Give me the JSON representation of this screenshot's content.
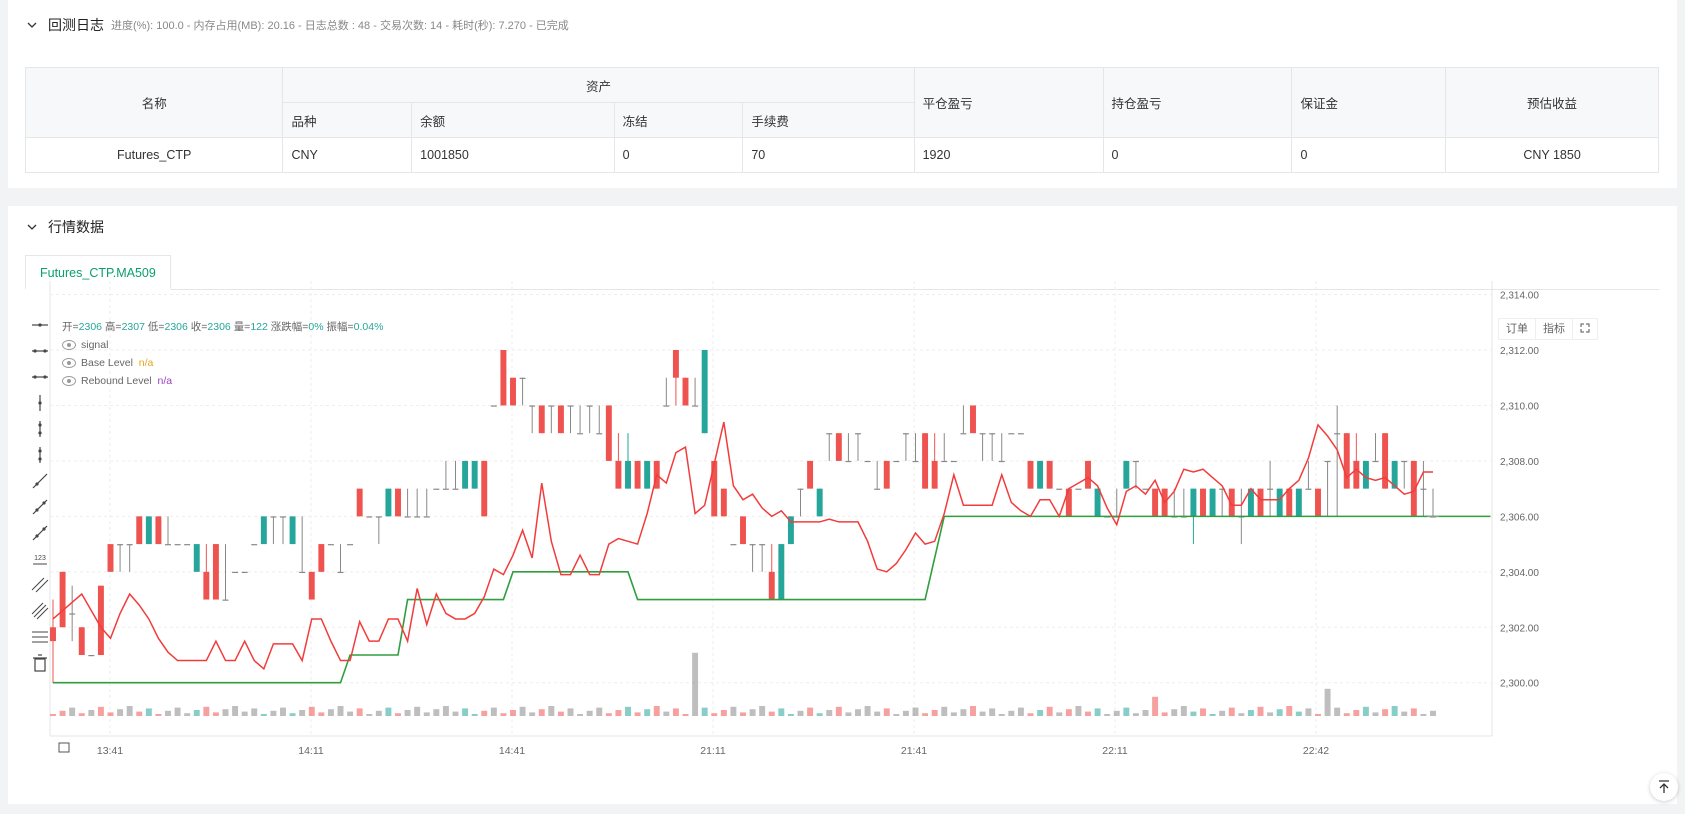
{
  "log_panel": {
    "title": "回测日志",
    "summary": "进度(%): 100.0  - 内存占用(MB): 20.16 - 日志总数 : 48 - 交易次数:  14 - 耗时(秒): 7.270 - 已完成"
  },
  "asset_table": {
    "header_name": "名称",
    "header_assets": "资产",
    "sub_headers": [
      "品种",
      "余额",
      "冻结",
      "手续费"
    ],
    "header_close_pnl": "平仓盈亏",
    "header_pos_pnl": "持仓盈亏",
    "header_margin": "保证金",
    "header_est": "预估收益",
    "row": {
      "name": "Futures_CTP",
      "symbol": "CNY",
      "balance": "1001850",
      "frozen": "0",
      "fee": "70",
      "close_pnl": "1920",
      "pos_pnl": "0",
      "margin": "0",
      "est": "CNY 1850"
    }
  },
  "market_panel": {
    "title": "行情数据",
    "tab": "Futures_CTP.MA509"
  },
  "chart_ui": {
    "btn_orders": "订单",
    "btn_indicators": "指标",
    "ohlc": {
      "open_label": "开=",
      "open": "2306",
      "high_label": "高=",
      "high": "2307",
      "low_label": "低=",
      "low": "2306",
      "close_label": "收=",
      "close": "2306",
      "vol_label": "量=",
      "vol": "122",
      "chg_label": "涨跌幅=",
      "chg": "0%",
      "amp_label": "振幅=",
      "amp": "0.04%"
    },
    "legend_signal": "signal",
    "legend_base": "Base Level",
    "legend_base_val": "n/a",
    "legend_rebound": "Rebound Level",
    "legend_rebound_val": "n/a",
    "colors": {
      "up": "#26a69a",
      "down": "#ef5350",
      "base": "#2e9e3e",
      "rebound": "#f23c3c",
      "accent": "#0a9f6b"
    },
    "tools": [
      "horizontal-line-icon",
      "horizontal-ray-icon",
      "horizontal-segment-icon",
      "vertical-line-icon",
      "vertical-ray-icon",
      "vertical-segment-icon",
      "trend-line-icon",
      "ray-line-icon",
      "segment-icon",
      "price-label-icon",
      "parallel-channel-icon",
      "fib-icon",
      "fib-lines-icon",
      "trash-icon"
    ]
  },
  "chart_data": {
    "type": "candlestick",
    "y_ticks": [
      "2,314.00",
      "2,312.00",
      "2,310.00",
      "2,308.00",
      "2,306.00",
      "2,304.00",
      "2,302.00",
      "2,300.00"
    ],
    "ylim": [
      2298.8,
      2314.2
    ],
    "x_ticks": [
      "13:41",
      "14:11",
      "14:41",
      "21:11",
      "21:41",
      "22:11",
      "22:42"
    ],
    "candles": [
      [
        2302.0,
        2303.0,
        2300.0,
        2301.5
      ],
      [
        2304.0,
        2303.0,
        2304.0,
        2302.0
      ],
      [
        2302.5,
        2303.5,
        2301.5,
        2302.5
      ],
      [
        2302.0,
        2301.0,
        2302.0,
        2301.0
      ],
      [
        2301.0,
        2301.0,
        2301.0,
        2301.0
      ],
      [
        2303.5,
        2303.5,
        2301.0,
        2301.0
      ],
      [
        2305.0,
        2305.0,
        2305.0,
        2304.0
      ],
      [
        2305.0,
        2305.0,
        2304.0,
        2305.0
      ],
      [
        2305.0,
        2305.0,
        2304.0,
        2305.0
      ],
      [
        2306.0,
        2306.0,
        2305.0,
        2305.0
      ],
      [
        2305.0,
        2306.0,
        2305.0,
        2306.0
      ],
      [
        2306.0,
        2306.0,
        2305.0,
        2305.0
      ],
      [
        2305.0,
        2306.0,
        2305.0,
        2305.0
      ],
      [
        2305.0,
        2305.0,
        2305.0,
        2305.0
      ],
      [
        2305.0,
        2305.0,
        2305.0,
        2305.0
      ],
      [
        2304.0,
        2305.0,
        2304.0,
        2305.0
      ],
      [
        2304.0,
        2305.0,
        2304.0,
        2303.0
      ],
      [
        2305.0,
        2305.0,
        2303.0,
        2303.0
      ],
      [
        2303.0,
        2305.0,
        2303.0,
        2303.0
      ],
      [
        2304.0,
        2304.0,
        2304.0,
        2304.0
      ],
      [
        2304.0,
        2304.0,
        2304.0,
        2304.0
      ],
      [
        2305.0,
        2305.0,
        2305.0,
        2305.0
      ],
      [
        2305.0,
        2306.0,
        2305.0,
        2306.0
      ],
      [
        2306.0,
        2306.0,
        2305.0,
        2306.0
      ],
      [
        2306.0,
        2306.0,
        2305.0,
        2306.0
      ],
      [
        2305.0,
        2306.0,
        2305.0,
        2306.0
      ],
      [
        2304.0,
        2306.0,
        2304.0,
        2304.0
      ],
      [
        2304.0,
        2304.0,
        2303.0,
        2303.0
      ],
      [
        2305.0,
        2304.0,
        2305.0,
        2304.0
      ],
      [
        2305.0,
        2305.0,
        2305.0,
        2305.0
      ],
      [
        2304.0,
        2305.0,
        2304.0,
        2304.0
      ],
      [
        2305.0,
        2305.0,
        2305.0,
        2305.0
      ],
      [
        2307.0,
        2307.0,
        2306.0,
        2306.0
      ],
      [
        2306.0,
        2306.0,
        2306.0,
        2306.0
      ],
      [
        2306.0,
        2306.0,
        2305.0,
        2306.0
      ],
      [
        2306.0,
        2307.0,
        2306.0,
        2307.0
      ],
      [
        2307.0,
        2307.0,
        2306.0,
        2306.0
      ],
      [
        2306.0,
        2307.0,
        2306.0,
        2306.0
      ],
      [
        2306.0,
        2307.0,
        2306.0,
        2306.0
      ],
      [
        2306.0,
        2307.0,
        2306.0,
        2306.0
      ],
      [
        2307.0,
        2307.0,
        2307.0,
        2307.0
      ],
      [
        2307.0,
        2308.0,
        2307.0,
        2307.0
      ],
      [
        2307.0,
        2308.0,
        2307.0,
        2307.0
      ],
      [
        2307.0,
        2308.0,
        2307.0,
        2308.0
      ],
      [
        2307.0,
        2308.0,
        2307.0,
        2308.0
      ],
      [
        2308.0,
        2308.0,
        2306.0,
        2306.0
      ],
      [
        2310.0,
        2310.0,
        2310.0,
        2310.0
      ],
      [
        2312.0,
        2312.0,
        2310.0,
        2310.0
      ],
      [
        2311.0,
        2311.0,
        2310.0,
        2310.0
      ],
      [
        2311.0,
        2311.0,
        2310.0,
        2311.0
      ],
      [
        2310.0,
        2310.0,
        2309.0,
        2310.0
      ],
      [
        2310.0,
        2310.0,
        2309.0,
        2309.0
      ],
      [
        2310.0,
        2310.0,
        2309.0,
        2310.0
      ],
      [
        2310.0,
        2310.0,
        2309.0,
        2309.0
      ],
      [
        2310.0,
        2310.0,
        2309.0,
        2310.0
      ],
      [
        2309.0,
        2310.0,
        2309.0,
        2309.0
      ],
      [
        2310.0,
        2310.0,
        2309.0,
        2310.0
      ],
      [
        2309.0,
        2310.0,
        2309.0,
        2309.0
      ],
      [
        2310.0,
        2310.0,
        2308.0,
        2308.0
      ],
      [
        2308.0,
        2309.0,
        2307.0,
        2307.0
      ],
      [
        2307.0,
        2309.0,
        2307.0,
        2308.0
      ],
      [
        2308.0,
        2308.0,
        2307.0,
        2307.0
      ],
      [
        2307.0,
        2308.0,
        2307.0,
        2308.0
      ],
      [
        2308.0,
        2308.0,
        2307.0,
        2307.0
      ],
      [
        2310.0,
        2311.0,
        2310.0,
        2310.0
      ],
      [
        2312.0,
        2312.0,
        2310.0,
        2311.0
      ],
      [
        2311.0,
        2311.0,
        2310.0,
        2310.0
      ],
      [
        2310.0,
        2311.0,
        2310.0,
        2310.0
      ],
      [
        2309.0,
        2312.0,
        2309.0,
        2312.0
      ],
      [
        2308.0,
        2308.0,
        2306.0,
        2306.0
      ],
      [
        2307.0,
        2307.0,
        2306.0,
        2306.0
      ],
      [
        2305.0,
        2305.0,
        2305.0,
        2305.0
      ],
      [
        2306.0,
        2306.0,
        2305.0,
        2305.0
      ],
      [
        2305.0,
        2305.0,
        2304.0,
        2305.0
      ],
      [
        2305.0,
        2305.0,
        2304.0,
        2305.0
      ],
      [
        2304.0,
        2305.0,
        2303.0,
        2303.0
      ],
      [
        2303.0,
        2305.0,
        2303.0,
        2305.0
      ],
      [
        2305.0,
        2306.0,
        2305.0,
        2306.0
      ],
      [
        2307.0,
        2307.0,
        2306.0,
        2307.0
      ],
      [
        2308.0,
        2308.0,
        2307.0,
        2307.0
      ],
      [
        2306.0,
        2307.0,
        2306.0,
        2307.0
      ],
      [
        2309.0,
        2309.0,
        2308.0,
        2309.0
      ],
      [
        2309.0,
        2309.0,
        2308.0,
        2308.0
      ],
      [
        2308.0,
        2309.0,
        2308.0,
        2308.0
      ],
      [
        2309.0,
        2309.0,
        2308.0,
        2309.0
      ],
      [
        2308.0,
        2308.0,
        2308.0,
        2308.0
      ],
      [
        2307.0,
        2308.0,
        2307.0,
        2307.0
      ],
      [
        2308.0,
        2308.0,
        2307.0,
        2307.0
      ],
      [
        2308.0,
        2308.0,
        2308.0,
        2308.0
      ],
      [
        2309.0,
        2309.0,
        2308.0,
        2309.0
      ],
      [
        2308.0,
        2309.0,
        2308.0,
        2308.0
      ],
      [
        2309.0,
        2309.0,
        2307.0,
        2307.0
      ],
      [
        2308.0,
        2309.0,
        2307.0,
        2307.0
      ],
      [
        2308.0,
        2309.0,
        2308.0,
        2308.0
      ],
      [
        2308.0,
        2308.0,
        2308.0,
        2308.0
      ],
      [
        2309.0,
        2310.0,
        2309.0,
        2309.0
      ],
      [
        2310.0,
        2310.0,
        2309.0,
        2309.0
      ],
      [
        2309.0,
        2309.0,
        2308.0,
        2309.0
      ],
      [
        2309.0,
        2309.0,
        2308.0,
        2309.0
      ],
      [
        2308.0,
        2309.0,
        2308.0,
        2308.0
      ],
      [
        2309.0,
        2309.0,
        2309.0,
        2309.0
      ],
      [
        2309.0,
        2309.0,
        2309.0,
        2309.0
      ],
      [
        2308.0,
        2308.0,
        2307.0,
        2307.0
      ],
      [
        2307.0,
        2308.0,
        2307.0,
        2308.0
      ],
      [
        2308.0,
        2308.0,
        2307.0,
        2307.0
      ],
      [
        2307.0,
        2307.0,
        2307.0,
        2307.0
      ],
      [
        2307.0,
        2307.0,
        2306.0,
        2306.0
      ],
      [
        2307.0,
        2307.0,
        2307.0,
        2307.0
      ],
      [
        2308.0,
        2308.0,
        2307.0,
        2307.0
      ],
      [
        2306.0,
        2307.0,
        2306.0,
        2307.0
      ],
      [
        2306.0,
        2306.0,
        2306.0,
        2306.0
      ],
      [
        2306.0,
        2307.0,
        2306.0,
        2306.0
      ],
      [
        2307.0,
        2308.0,
        2307.0,
        2308.0
      ],
      [
        2308.0,
        2308.0,
        2307.0,
        2308.0
      ],
      [
        2307.0,
        2307.0,
        2307.0,
        2307.0
      ],
      [
        2307.0,
        2307.0,
        2306.0,
        2306.0
      ],
      [
        2307.0,
        2307.0,
        2306.0,
        2306.0
      ],
      [
        2306.0,
        2307.0,
        2306.0,
        2306.0
      ],
      [
        2306.0,
        2307.0,
        2306.0,
        2306.0
      ],
      [
        2306.0,
        2307.0,
        2305.0,
        2307.0
      ],
      [
        2307.0,
        2307.0,
        2306.0,
        2306.0
      ],
      [
        2306.0,
        2307.0,
        2306.0,
        2307.0
      ],
      [
        2307.0,
        2307.0,
        2306.0,
        2307.0
      ],
      [
        2307.0,
        2307.0,
        2306.0,
        2306.0
      ],
      [
        2306.0,
        2307.0,
        2305.0,
        2306.0
      ],
      [
        2306.0,
        2307.0,
        2306.0,
        2307.0
      ],
      [
        2307.0,
        2307.0,
        2306.0,
        2306.0
      ],
      [
        2307.0,
        2308.0,
        2306.0,
        2307.0
      ],
      [
        2306.0,
        2307.0,
        2306.0,
        2307.0
      ],
      [
        2307.0,
        2307.0,
        2306.0,
        2306.0
      ],
      [
        2306.0,
        2307.0,
        2306.0,
        2307.0
      ],
      [
        2307.0,
        2308.0,
        2307.0,
        2307.0
      ],
      [
        2307.0,
        2307.0,
        2306.0,
        2306.0
      ],
      [
        2308.0,
        2308.0,
        2306.0,
        2308.0
      ],
      [
        2309.0,
        2310.0,
        2306.0,
        2309.0
      ],
      [
        2309.0,
        2309.0,
        2307.0,
        2307.0
      ],
      [
        2308.0,
        2309.0,
        2307.0,
        2307.0
      ],
      [
        2307.0,
        2308.0,
        2307.0,
        2308.0
      ],
      [
        2308.0,
        2309.0,
        2308.0,
        2308.0
      ],
      [
        2309.0,
        2309.0,
        2307.0,
        2307.0
      ],
      [
        2307.0,
        2308.0,
        2307.0,
        2308.0
      ],
      [
        2308.0,
        2308.0,
        2307.0,
        2308.0
      ],
      [
        2308.0,
        2308.0,
        2306.0,
        2306.0
      ],
      [
        2307.0,
        2308.0,
        2306.0,
        2307.0
      ],
      [
        2306.0,
        2307.0,
        2306.0,
        2306.0
      ]
    ],
    "base_level": [
      [
        0,
        2300.0
      ],
      [
        30,
        2300.0
      ],
      [
        31,
        2301.0
      ],
      [
        36,
        2301.0
      ],
      [
        37,
        2303.0
      ],
      [
        47,
        2303.0
      ],
      [
        48,
        2304.0
      ],
      [
        60,
        2304.0
      ],
      [
        61,
        2303.0
      ],
      [
        91,
        2303.0
      ],
      [
        93,
        2306.0
      ],
      [
        150,
        2306.0
      ]
    ],
    "rebound_level": [
      2302.3,
      2302.6,
      2302.9,
      2303.2,
      2302.6,
      2302.0,
      2301.6,
      2302.5,
      2303.2,
      2302.8,
      2302.3,
      2301.6,
      2301.1,
      2300.8,
      2300.8,
      2300.8,
      2300.8,
      2301.5,
      2300.8,
      2300.8,
      2301.5,
      2300.8,
      2300.5,
      2301.4,
      2301.4,
      2301.4,
      2300.8,
      2302.3,
      2302.3,
      2301.5,
      2300.8,
      2300.8,
      2302.2,
      2301.5,
      2301.5,
      2302.3,
      2302.3,
      2301.5,
      2303.4,
      2302.1,
      2303.2,
      2302.5,
      2302.3,
      2302.3,
      2302.5,
      2303.1,
      2304.1,
      2303.9,
      2304.6,
      2305.5,
      2304.5,
      2307.2,
      2305.1,
      2303.9,
      2303.9,
      2304.6,
      2303.9,
      2303.9,
      2305.0,
      2305.2,
      2305.1,
      2305.0,
      2306.1,
      2307.5,
      2307.2,
      2308.3,
      2308.5,
      2306.1,
      2306.4,
      2307.9,
      2309.4,
      2307.1,
      2306.6,
      2306.8,
      2306.3,
      2306.0,
      2306.2,
      2305.8,
      2305.8,
      2305.8,
      2305.8,
      2305.9,
      2305.8,
      2305.8,
      2305.8,
      2305.1,
      2304.1,
      2304.0,
      2304.3,
      2304.8,
      2305.4,
      2305.0,
      2305.1,
      2306.1,
      2307.5,
      2306.4,
      2306.4,
      2306.4,
      2306.4,
      2307.5,
      2306.5,
      2306.2,
      2306.0,
      2306.6,
      2306.6,
      2306.0,
      2307.0,
      2307.2,
      2307.4,
      2307.1,
      2306.3,
      2305.7,
      2306.9,
      2307.1,
      2306.8,
      2307.3,
      2306.5,
      2306.9,
      2307.7,
      2307.6,
      2307.7,
      2307.4,
      2307.1,
      2306.4,
      2306.4,
      2307.0,
      2306.6,
      2306.6,
      2306.6,
      2307.0,
      2307.3,
      2308.1,
      2309.3,
      2308.9,
      2308.4,
      2307.4,
      2307.7,
      2307.4,
      2307.3,
      2307.4,
      2307.1,
      2306.8,
      2306.9,
      2307.6,
      2307.6
    ]
  }
}
